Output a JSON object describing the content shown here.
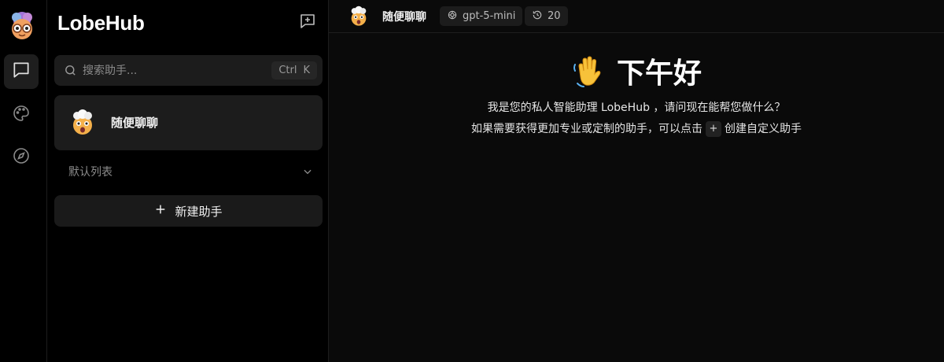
{
  "app": {
    "brand": "LobeHub"
  },
  "rail": {
    "items": [
      {
        "icon": "chat-icon",
        "active": true
      },
      {
        "icon": "palette-icon",
        "active": false
      },
      {
        "icon": "compass-icon",
        "active": false
      }
    ]
  },
  "sidebar": {
    "search": {
      "placeholder": "搜索助手...",
      "shortcut_mod": "Ctrl",
      "shortcut_key": "K"
    },
    "agents": [
      {
        "name": "随便聊聊"
      }
    ],
    "group": {
      "label": "默认列表"
    },
    "new_agent_label": "新建助手"
  },
  "header": {
    "title": "随便聊聊",
    "model": "gpt-5-mini",
    "history_count": "20"
  },
  "welcome": {
    "greeting": "下午好",
    "line1": "我是您的私人智能助理 LobeHub ，请问现在能帮您做什么？",
    "line2_before": "如果需要获得更加专业或定制的助手，可以点击",
    "line2_chip": "+",
    "line2_after": "创建自定义助手"
  },
  "colors": {
    "background": "#000000",
    "panel": "#1c1c1c",
    "text": "#e8e8e8",
    "muted": "#8c8c8c"
  }
}
